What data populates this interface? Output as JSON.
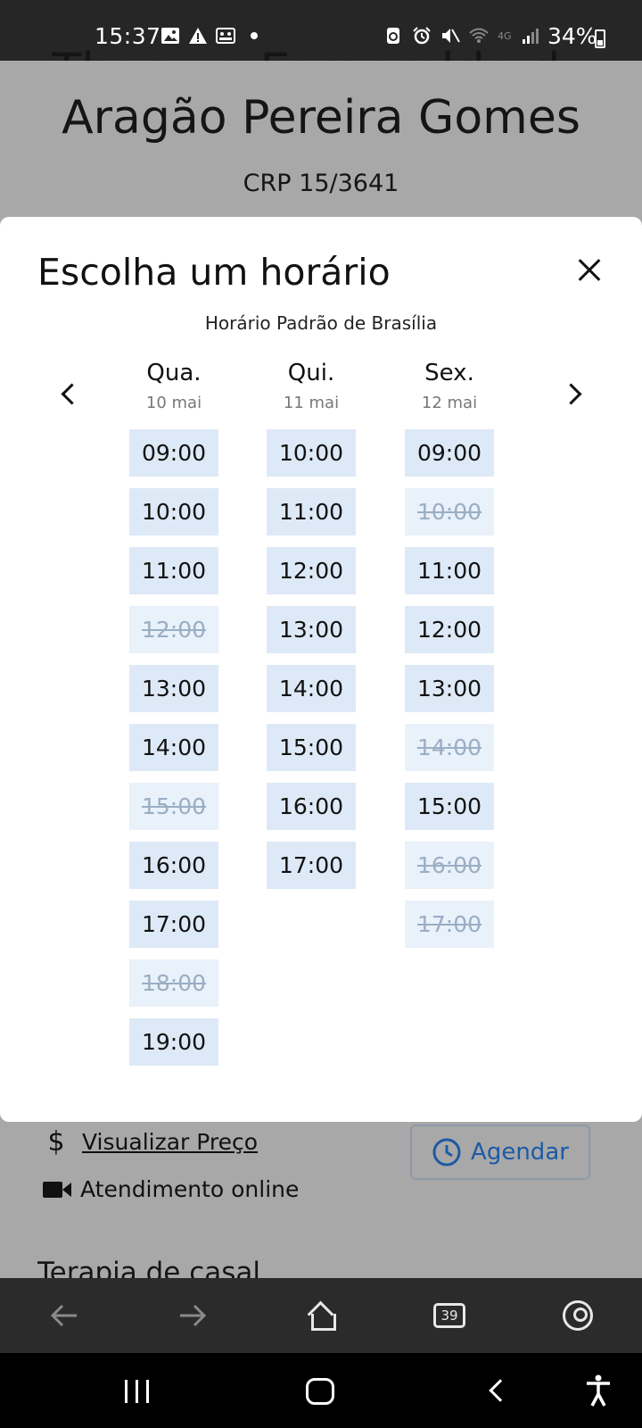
{
  "status_bar": {
    "time": "15:37",
    "battery": "34%",
    "network": "4G",
    "icons_left": [
      "image-icon",
      "warning-icon",
      "contacts-icon"
    ],
    "icons_right": [
      "recycle-icon",
      "alarm-icon",
      "mute-icon",
      "wifi-icon",
      "signal-icon"
    ]
  },
  "background_page": {
    "name_partial": "Thereza Esmeralda de",
    "name": "Aragão Pereira Gomes",
    "crp": "CRP 15/3641",
    "price_link": "Visualizar Preço",
    "online_label": "Atendimento online",
    "agendar_label": "Agendar",
    "next_section": "Terapia de casal"
  },
  "modal": {
    "title": "Escolha um horário",
    "subtitle": "Horário Padrão de Brasília",
    "days": [
      {
        "name": "Qua.",
        "date": "10 mai",
        "slots": [
          {
            "time": "09:00",
            "available": true
          },
          {
            "time": "10:00",
            "available": true
          },
          {
            "time": "11:00",
            "available": true
          },
          {
            "time": "12:00",
            "available": false
          },
          {
            "time": "13:00",
            "available": true
          },
          {
            "time": "14:00",
            "available": true
          },
          {
            "time": "15:00",
            "available": false
          },
          {
            "time": "16:00",
            "available": true
          },
          {
            "time": "17:00",
            "available": true
          },
          {
            "time": "18:00",
            "available": false
          },
          {
            "time": "19:00",
            "available": true
          }
        ]
      },
      {
        "name": "Qui.",
        "date": "11 mai",
        "slots": [
          {
            "time": "10:00",
            "available": true
          },
          {
            "time": "11:00",
            "available": true
          },
          {
            "time": "12:00",
            "available": true
          },
          {
            "time": "13:00",
            "available": true
          },
          {
            "time": "14:00",
            "available": true
          },
          {
            "time": "15:00",
            "available": true
          },
          {
            "time": "16:00",
            "available": true
          },
          {
            "time": "17:00",
            "available": true
          }
        ]
      },
      {
        "name": "Sex.",
        "date": "12 mai",
        "slots": [
          {
            "time": "09:00",
            "available": true
          },
          {
            "time": "10:00",
            "available": false
          },
          {
            "time": "11:00",
            "available": true
          },
          {
            "time": "12:00",
            "available": true
          },
          {
            "time": "13:00",
            "available": true
          },
          {
            "time": "14:00",
            "available": false
          },
          {
            "time": "15:00",
            "available": true
          },
          {
            "time": "16:00",
            "available": false
          },
          {
            "time": "17:00",
            "available": false
          }
        ]
      }
    ]
  },
  "browser_toolbar": {
    "tab_count": "39"
  }
}
